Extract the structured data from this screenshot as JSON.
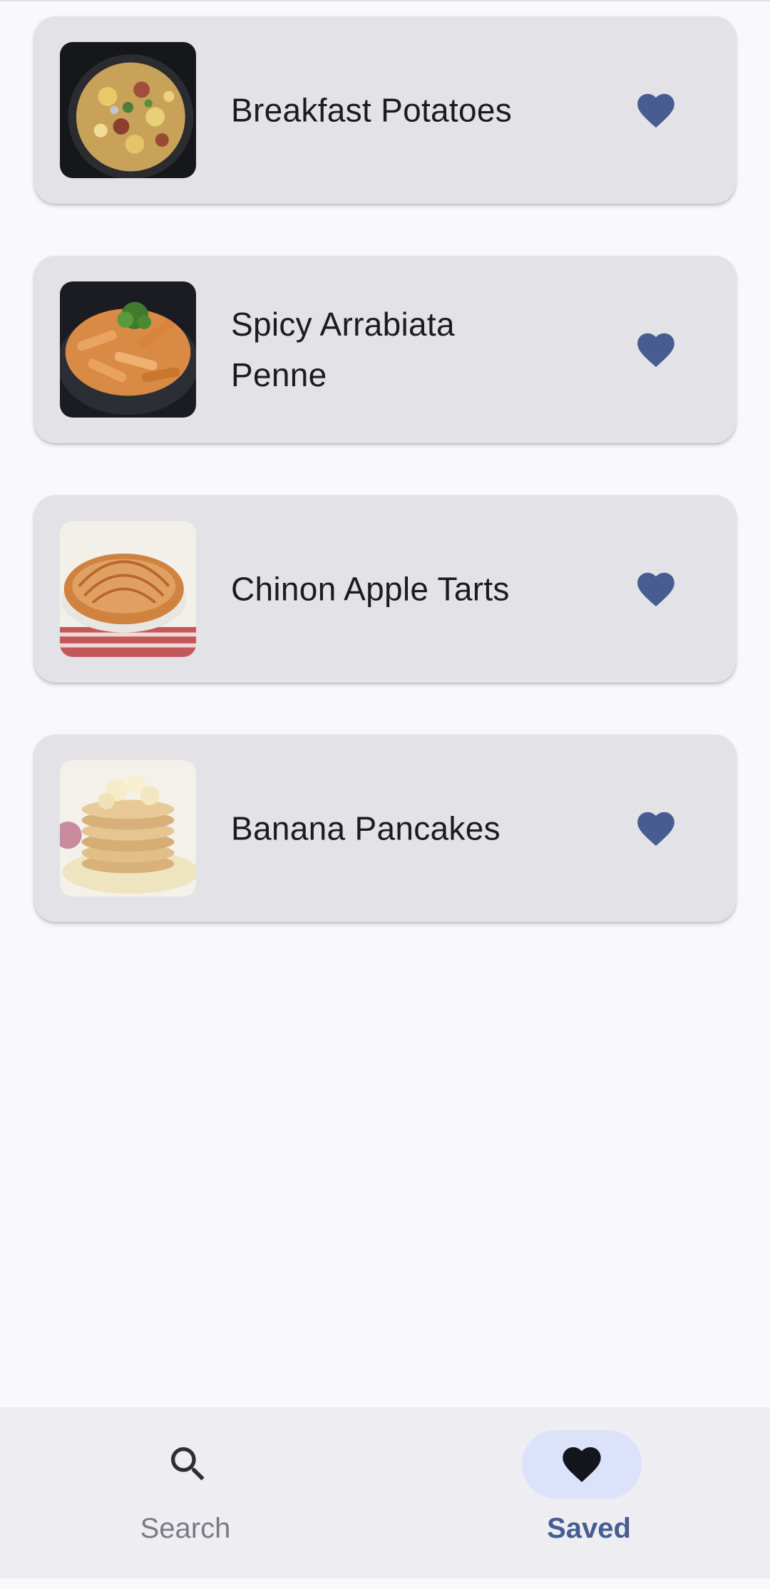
{
  "colors": {
    "background": "#f8f8fd",
    "card": "#e3e2e7",
    "accent": "#475d92",
    "nav_background": "#ededf2",
    "nav_indicator": "#dce2f9"
  },
  "recipes": [
    {
      "title": "Breakfast Potatoes",
      "favorite_icon": "heart-filled-icon"
    },
    {
      "title": "Spicy Arrabiata Penne",
      "favorite_icon": "heart-filled-icon"
    },
    {
      "title": "Chinon Apple Tarts",
      "favorite_icon": "heart-filled-icon"
    },
    {
      "title": "Banana Pancakes",
      "favorite_icon": "heart-filled-icon"
    }
  ],
  "bottom_nav": {
    "items": [
      {
        "label": "Search",
        "icon": "search-icon",
        "selected": false
      },
      {
        "label": "Saved",
        "icon": "heart-icon",
        "selected": true
      }
    ]
  }
}
